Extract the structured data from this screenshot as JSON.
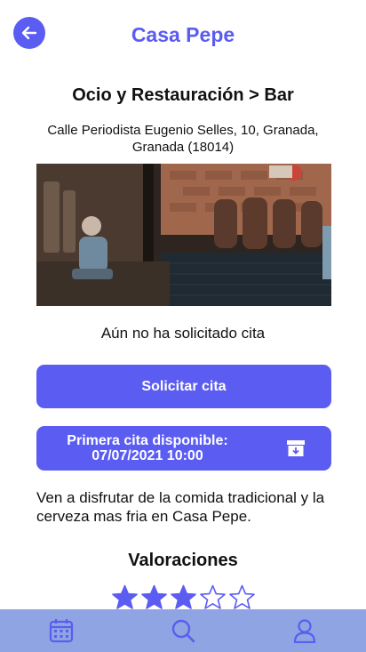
{
  "header": {
    "title": "Casa Pepe",
    "back_icon": "arrow-left-icon"
  },
  "business": {
    "category": "Ocio y Restauración > Bar",
    "address": "Calle Periodista Eugenio Selles, 10, Granada, Granada (18014)",
    "status": "Aún no ha solicitado cita",
    "description": "Ven a disfrutar de la comida tradicional y la cerveza mas fria en Casa Pepe."
  },
  "actions": {
    "request_label": "Solicitar cita",
    "next_line1": "Primera cita disponible:",
    "next_line2": "07/07/2021 10:00",
    "next_icon": "archive-icon"
  },
  "ratings": {
    "title": "Valoraciones",
    "value": 3,
    "max": 5
  },
  "nav": {
    "items": [
      "calendar-icon",
      "search-icon",
      "user-icon"
    ]
  },
  "colors": {
    "accent": "#5a5cf2",
    "nav_bg": "#8fa4e2"
  }
}
